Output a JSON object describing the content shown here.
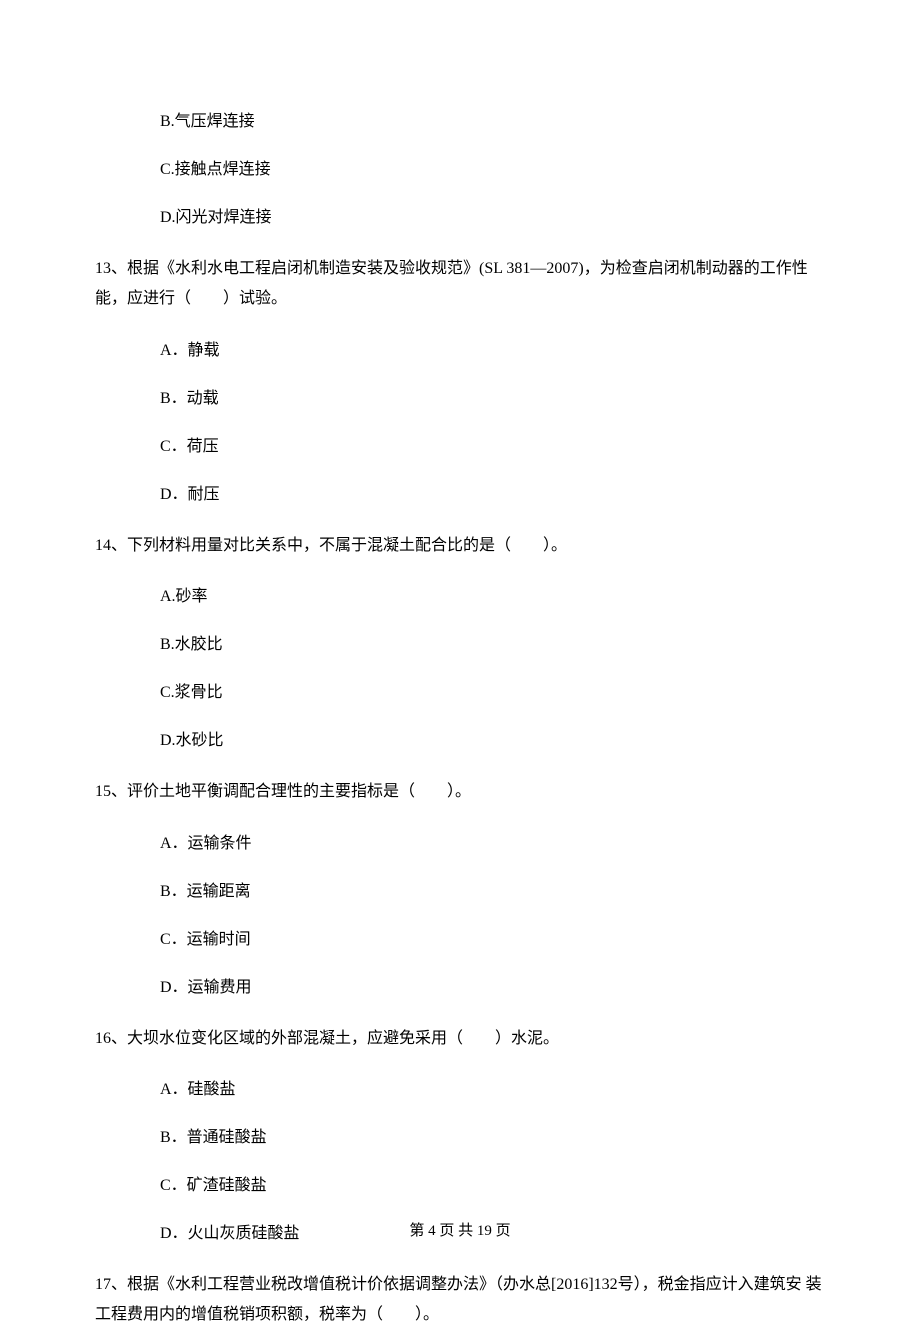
{
  "q12_opts": {
    "b": "B.气压焊连接",
    "c": "C.接触点焊连接",
    "d": "D.闪光对焊连接"
  },
  "q13": {
    "text": "13、根据《水利水电工程启闭机制造安装及验收规范》(SL 381—2007)，为检查启闭机制动器的工作性能，应进行（　　）试验。",
    "a": "A．静载",
    "b": "B．动载",
    "c": "C．荷压",
    "d": "D．耐压"
  },
  "q14": {
    "text": "14、下列材料用量对比关系中，不属于混凝土配合比的是（　　）。",
    "a": "A.砂率",
    "b": "B.水胶比",
    "c": "C.浆骨比",
    "d": "D.水砂比"
  },
  "q15": {
    "text": "15、评价土地平衡调配合理性的主要指标是（　　）。",
    "a": "A．运输条件",
    "b": "B．运输距离",
    "c": "C．运输时间",
    "d": "D．运输费用"
  },
  "q16": {
    "text": "16、大坝水位变化区域的外部混凝土，应避免采用（　　）水泥。",
    "a": "A．硅酸盐",
    "b": "B．普通硅酸盐",
    "c": "C．矿渣硅酸盐",
    "d": "D．火山灰质硅酸盐"
  },
  "q17": {
    "text": "17、根据《水利工程营业税改增值税计价依据调整办法》（办水总[2016]132号），税金指应计入建筑安 装工程费用内的增值税销项积额，税率为（　　）。"
  },
  "footer": "第 4 页 共 19 页"
}
